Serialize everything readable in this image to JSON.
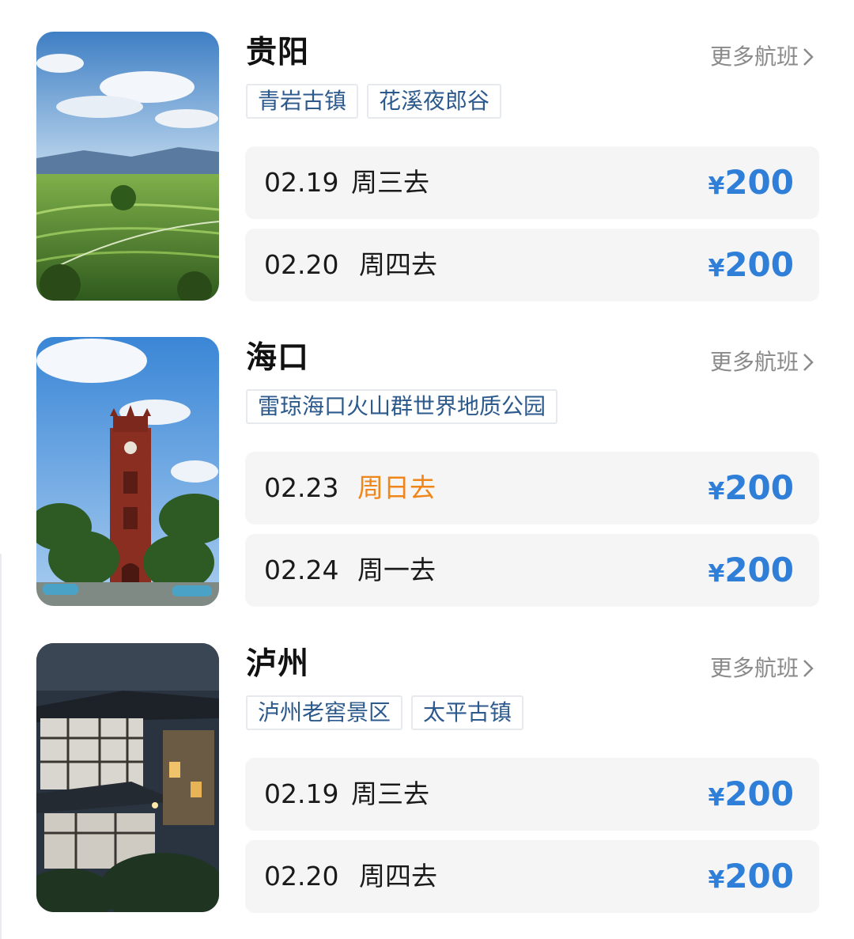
{
  "more_label": "更多航班",
  "colors": {
    "price": "#2f7fd8",
    "weekend": "#f08519",
    "tag_text": "#2d5a8c",
    "row_bg": "#f5f5f5"
  },
  "cards": [
    {
      "city": "贵阳",
      "image": "terraced-fields-photo",
      "tags": [
        "青岩古镇",
        "花溪夜郎谷"
      ],
      "flights": [
        {
          "date": "02.19",
          "day": "周三去",
          "currency": "¥",
          "price": "200"
        },
        {
          "date": "02.20",
          "day": "周四去",
          "currency": "¥",
          "price": "200"
        }
      ]
    },
    {
      "city": "海口",
      "image": "clock-tower-photo",
      "tags": [
        "雷琼海口火山群世界地质公园"
      ],
      "flights": [
        {
          "date": "02.23",
          "day": "周日去",
          "currency": "¥",
          "price": "200",
          "weekend": true
        },
        {
          "date": "02.24",
          "day": "周一去",
          "currency": "¥",
          "price": "200"
        }
      ]
    },
    {
      "city": "泸州",
      "image": "old-town-night-photo",
      "tags": [
        "泸州老窖景区",
        "太平古镇"
      ],
      "flights": [
        {
          "date": "02.19",
          "day": "周三去",
          "currency": "¥",
          "price": "200"
        },
        {
          "date": "02.20",
          "day": "周四去",
          "currency": "¥",
          "price": "200"
        }
      ]
    }
  ]
}
